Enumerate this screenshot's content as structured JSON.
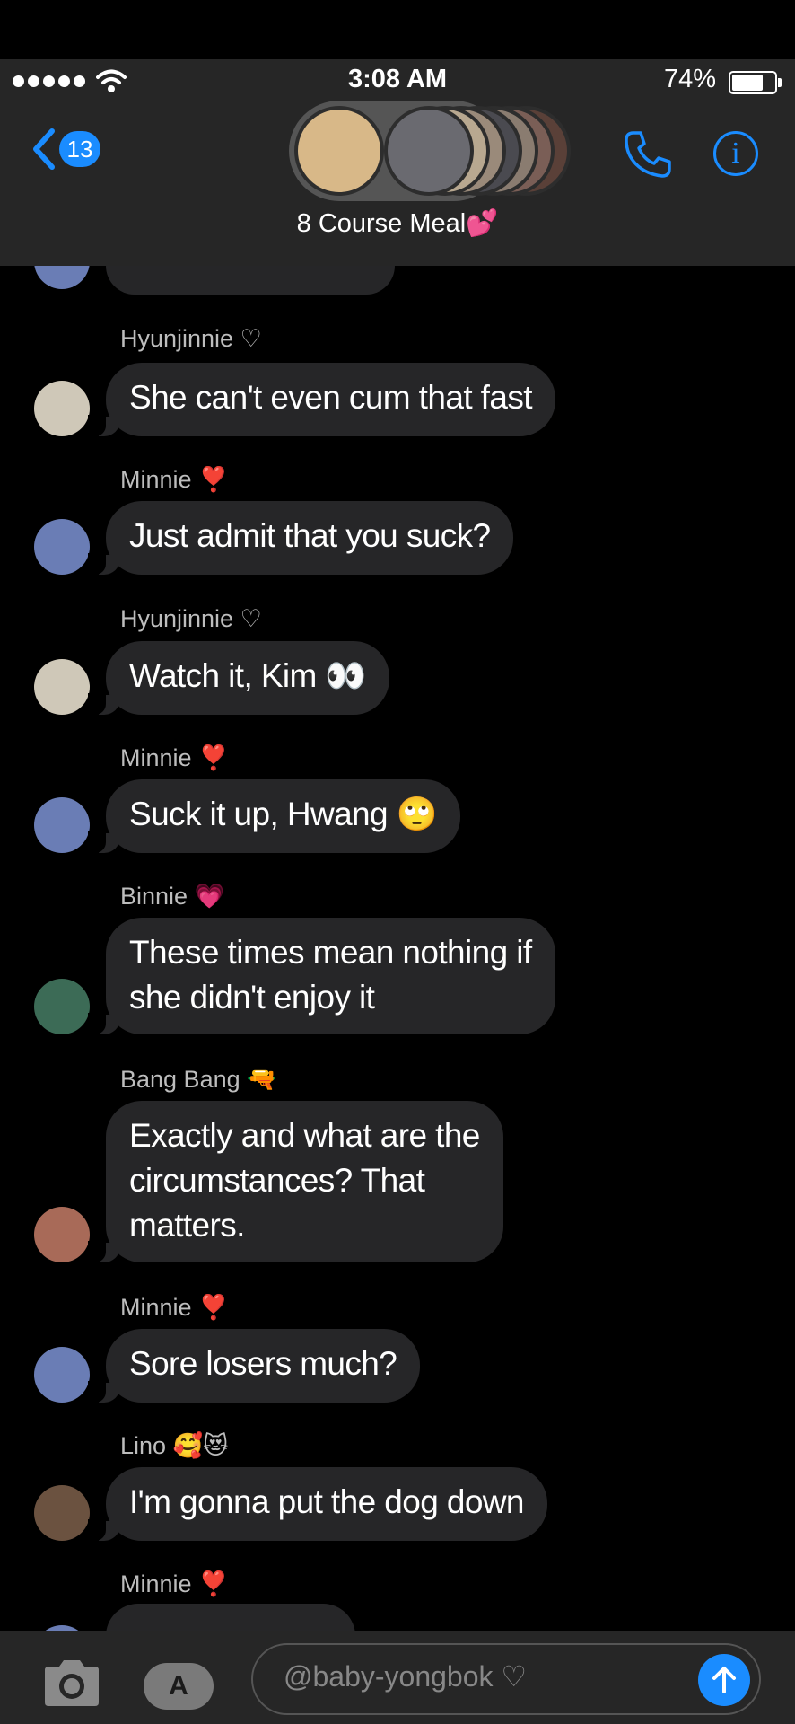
{
  "status": {
    "time": "3:08 AM",
    "battery": "74%"
  },
  "header": {
    "back_count": "13",
    "group_name": "8 Course Meal💕"
  },
  "messages": [
    {
      "sender": "Hyunjinnie ♡",
      "text": "She can't even cum that fast",
      "avatar_color": "#cfc8b8"
    },
    {
      "sender": "Minnie ❣️",
      "text": "Just admit that you suck?",
      "avatar_color": "#6a7db5"
    },
    {
      "sender": "Hyunjinnie ♡",
      "text": "Watch it, Kim 👀",
      "avatar_color": "#cfc8b8"
    },
    {
      "sender": "Minnie ❣️",
      "text": "Suck it up, Hwang 🙄",
      "avatar_color": "#6a7db5"
    },
    {
      "sender": "Binnie 💗",
      "text": "These times mean nothing if\nshe didn't enjoy it",
      "avatar_color": "#3c6b56"
    },
    {
      "sender": "Bang Bang 🔫",
      "text": "Exactly and what are the\ncircumstances? That\nmatters.",
      "avatar_color": "#a86a58"
    },
    {
      "sender": "Minnie ❣️",
      "text": "Sore losers much?",
      "avatar_color": "#6a7db5"
    },
    {
      "sender": "Lino 🥰😻",
      "text": "I'm gonna put the dog down",
      "avatar_color": "#6b5240"
    },
    {
      "sender": "Minnie ❣️"
    }
  ],
  "composer": {
    "placeholder": "@baby-yongbok ♡"
  },
  "colors": {
    "accent": "#1a8cff",
    "bubble": "#262628",
    "header_bg": "#262626"
  },
  "icons": [
    "wifi-icon",
    "battery-icon",
    "back-chevron-icon",
    "phone-icon",
    "info-icon",
    "camera-icon",
    "app-store-icon",
    "send-arrow-icon"
  ]
}
